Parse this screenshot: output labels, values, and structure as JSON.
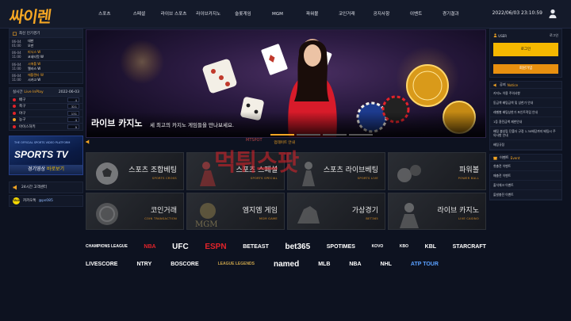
{
  "header": {
    "logo": "싸이렌",
    "nav": [
      "스포츠",
      "스페셜",
      "라이브 스포츠",
      "라이브카지노",
      "슬롯게임",
      "MGM",
      "파워볼",
      "코인거래",
      "공지사항",
      "이벤트",
      "경기결과"
    ],
    "clock": "2022/06/03 23:10:59"
  },
  "schedule": {
    "title": "최신 인기경기",
    "rows": [
      {
        "date": "06-04",
        "time": "01:00",
        "home": "대한",
        "away": "오만",
        "winner": ""
      },
      {
        "date": "06-04",
        "time": "11:00",
        "home": "피닉스 W",
        "away": "코네티컷 W",
        "winner": "home"
      },
      {
        "date": "06-04",
        "time": "11:00",
        "home": "시애틀 W",
        "away": "앨러스 W",
        "winner": "home"
      },
      {
        "date": "06-04",
        "time": "11:00",
        "home": "애틀랜타 W",
        "away": "시카고 W",
        "winner": "home"
      }
    ]
  },
  "live": {
    "title": "실시간",
    "title_accent": "Live InPlay",
    "date": "2022-06-03",
    "rows": [
      {
        "label": "배구",
        "count": "4",
        "color": "#e2232a"
      },
      {
        "label": "축구",
        "count": "321",
        "color": "#e2232a"
      },
      {
        "label": "야구",
        "count": "131",
        "color": "#e2232a"
      },
      {
        "label": "농구",
        "count": "4",
        "color": "#f5a623"
      },
      {
        "label": "아이스하키",
        "count": "9",
        "color": "#e2232a"
      }
    ]
  },
  "tv": {
    "caption": "THE OFFICIAL SPORTS VIDEO PLATFORM",
    "title": "SPORTS TV",
    "button": "경기영상",
    "button_accent": "바로보기"
  },
  "cs": {
    "hours": "24시간 고객센터",
    "kakao": "카카오톡",
    "kakao_id": "@ps085",
    "kakao_icon": "TALK"
  },
  "banner": {
    "title": "라이브 카지노",
    "subtitle": "세 최고의 카지노 게임들을 만나보세요."
  },
  "notice_bar": {
    "text": "업데이트 안내"
  },
  "tiles": [
    {
      "name": "스포츠 조합베팅",
      "en": "SPORTS CROSS"
    },
    {
      "name": "스포츠 스페셜",
      "en": "SPORTS SPECIAL"
    },
    {
      "name": "스포츠 라이브베팅",
      "en": "SPORTS LIVE"
    },
    {
      "name": "파워볼",
      "en": "POWER BALL"
    },
    {
      "name": "코인거래",
      "en": "COIN TRANSACTION"
    },
    {
      "name": "엠지엠 게임",
      "en": "MGM GAME"
    },
    {
      "name": "가상경기",
      "en": "BET365"
    },
    {
      "name": "라이브 카지노",
      "en": "LIVE CASINO"
    }
  ],
  "watermark": {
    "text": "먹튀스팟",
    "sub": "MTSPOT"
  },
  "login": {
    "label": "USER",
    "link": "로그인",
    "login_button": "로그인",
    "join_button": "회원가입"
  },
  "notice": {
    "title": "공지",
    "title_accent": "Notice",
    "items": [
      "카지노 이용 주의사항",
      "동금액 배팅금액 및 상한가 안내",
      "레벨별 배팅상한가 포인트적립 안내",
      "1등 환전금액 제한안내",
      "배팅 불성립 단폴더 규정 1.30배당까지 배팅시 주의사항 안내",
      "배팅규정"
    ]
  },
  "event": {
    "title": "이벤트",
    "title_accent": "Event",
    "items": [
      "첫충전 이벤트",
      "매충전 이벤트",
      "출석체크 이벤트",
      "돌발충전 이벤트"
    ]
  },
  "brands": {
    "row1": [
      "CHAMPIONS LEAGUE",
      "NBA",
      "UFC",
      "ESPN",
      "BETEAST",
      "bet365",
      "SPOTIMES",
      "KOVO",
      "KBO",
      "KBL",
      "STARCRAFT"
    ],
    "row2": [
      "LIVESCORE",
      "NTRY",
      "BOSCORE",
      "LEAGUE LEGENDS",
      "named",
      "MLB",
      "NBA",
      "NHL",
      "ATP TOUR"
    ]
  }
}
